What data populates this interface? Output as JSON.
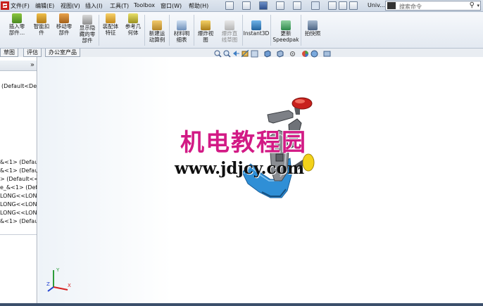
{
  "menubar": {
    "items": [
      "文件(F)",
      "编辑(E)",
      "视图(V)",
      "插入(I)",
      "工具(T)",
      "Toolbox",
      "窗口(W)",
      "帮助(H)"
    ],
    "document_tab": "Univ...",
    "search_placeholder": "搜索命令"
  },
  "ribbon": {
    "buttons": [
      {
        "line1": "插入零",
        "line2": "部件…",
        "line3": ""
      },
      {
        "line1": "智能扣",
        "line2": "件",
        "line3": ""
      },
      {
        "line1": "移动零",
        "line2": "部件",
        "line3": ""
      },
      {
        "line1": "显示隐",
        "line2": "藏的零",
        "line3": "部件"
      },
      {
        "line1": "装配体",
        "line2": "特征",
        "line3": ""
      },
      {
        "line1": "参考几",
        "line2": "何体",
        "line3": ""
      },
      {
        "line1": "新建运",
        "line2": "动算例",
        "line3": ""
      },
      {
        "line1": "材料明",
        "line2": "细表",
        "line3": ""
      },
      {
        "line1": "爆炸视",
        "line2": "图",
        "line3": ""
      },
      {
        "line1": "爆炸直",
        "line2": "线草图",
        "line3": ""
      },
      {
        "line1": "Instant3D",
        "line2": "",
        "line3": ""
      },
      {
        "line1": "更新",
        "line2": "Speedpak",
        "line3": ""
      },
      {
        "line1": "拍快照",
        "line2": "",
        "line3": ""
      }
    ]
  },
  "tabs": [
    "草图",
    "评估",
    "办公室产品"
  ],
  "panel": {
    "collapse_label": "»",
    "tree_items": [
      "(Default<Def",
      "&<1> (Defaul",
      "&<1> (Defau",
      "> (Default<<",
      "e_&<1> (Def",
      "LONG<<LON",
      "LONG<<LON",
      "LONG<<LON",
      "&<1> (Defaul"
    ]
  },
  "viewport": {
    "watermark_cn": "机电教程园",
    "watermark_url": "www.jdjcy.com"
  },
  "colors": {
    "part_red": "#c8201c",
    "part_blue": "#2f8fd6",
    "part_gray": "#8a8d92",
    "watermark_magenta": "#d21a85",
    "handle_yellow": "#f3d21a"
  }
}
